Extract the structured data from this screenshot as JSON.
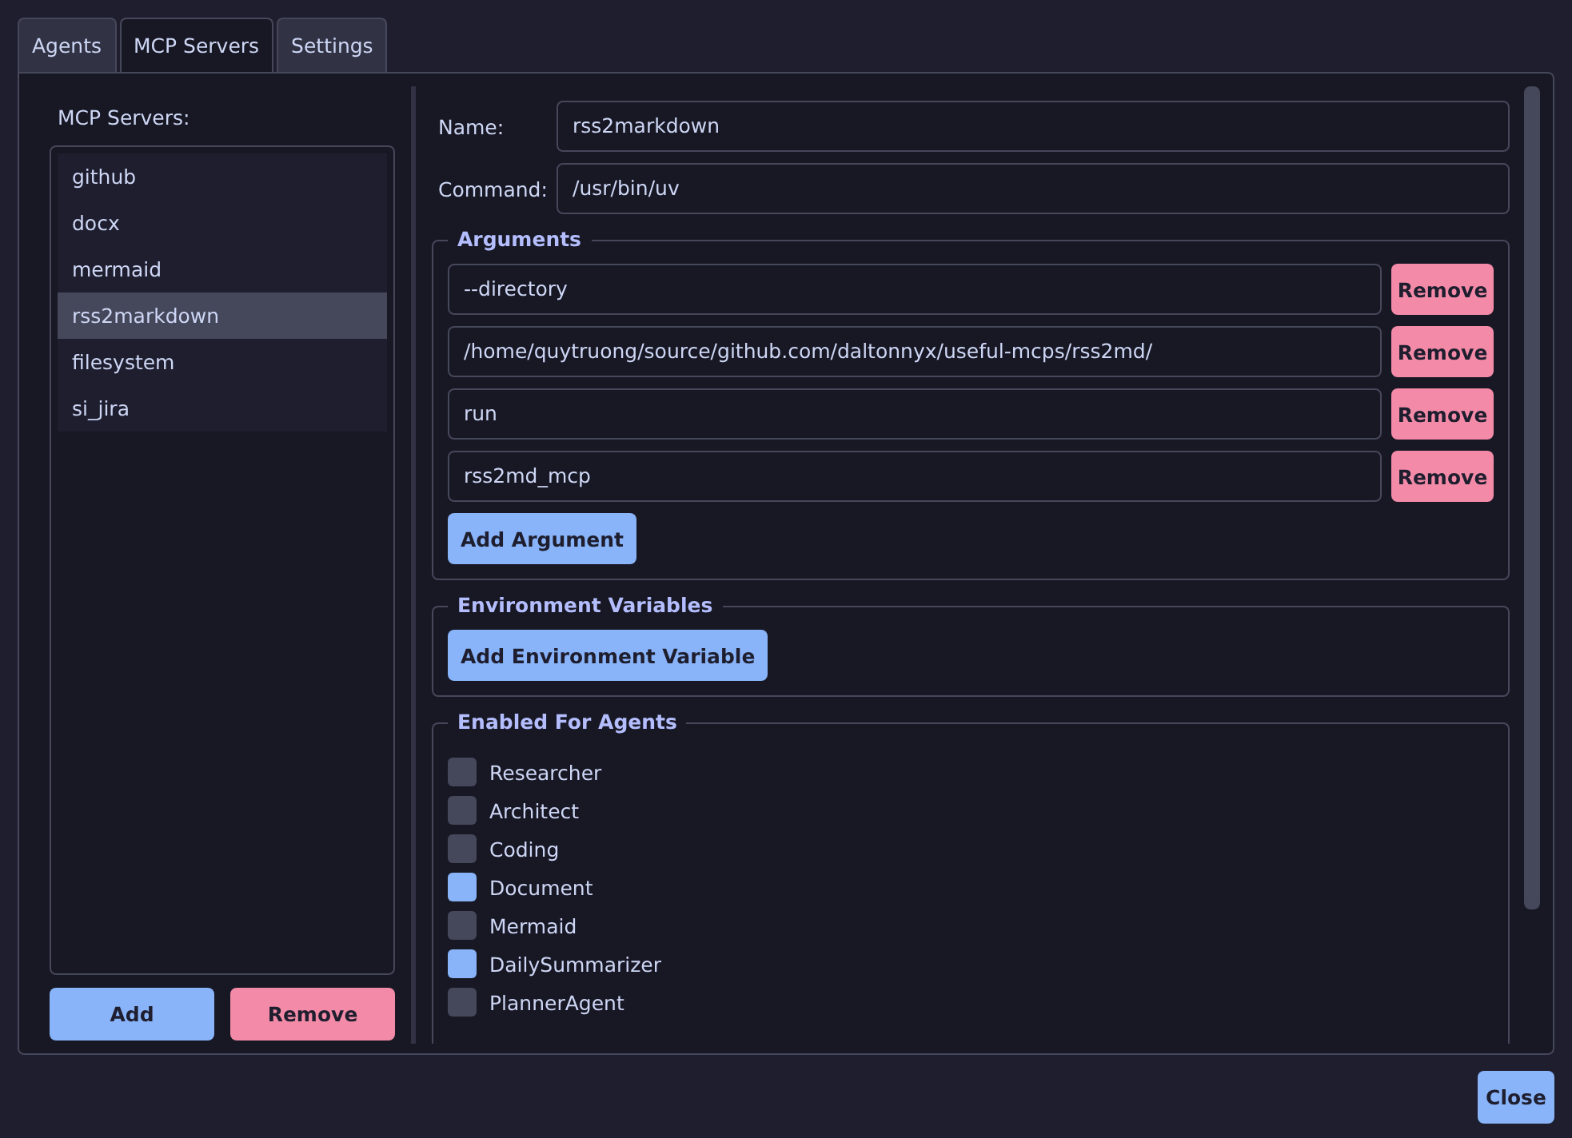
{
  "tabs": [
    {
      "label": "Agents",
      "selected": false
    },
    {
      "label": "MCP Servers",
      "selected": true
    },
    {
      "label": "Settings",
      "selected": false
    }
  ],
  "servers": {
    "title": "MCP Servers:",
    "items": [
      {
        "label": "github",
        "selected": false
      },
      {
        "label": "docx",
        "selected": false
      },
      {
        "label": "mermaid",
        "selected": false
      },
      {
        "label": "rss2markdown",
        "selected": true
      },
      {
        "label": "filesystem",
        "selected": false
      },
      {
        "label": "si_jira",
        "selected": false
      }
    ],
    "buttons": {
      "add": "Add",
      "remove": "Remove"
    }
  },
  "form": {
    "name_label": "Name:",
    "name": "rss2markdown",
    "command_label": "Command:",
    "command": "/usr/bin/uv"
  },
  "arguments": {
    "title": "Arguments",
    "items": [
      {
        "value": "--directory",
        "remove": "Remove"
      },
      {
        "value": "/home/quytruong/source/github.com/daltonnyx/useful-mcps/rss2md/",
        "remove": "Remove"
      },
      {
        "value": "run",
        "remove": "Remove"
      },
      {
        "value": "rss2md_mcp",
        "remove": "Remove"
      }
    ],
    "add": "Add Argument"
  },
  "environment": {
    "title": "Environment Variables",
    "add": "Add Environment Variable"
  },
  "agents": {
    "title": "Enabled For Agents",
    "items": [
      {
        "label": "Researcher",
        "checked": false
      },
      {
        "label": "Architect",
        "checked": false
      },
      {
        "label": "Coding",
        "checked": false
      },
      {
        "label": "Document",
        "checked": true
      },
      {
        "label": "Mermaid",
        "checked": false
      },
      {
        "label": "DailySummarizer",
        "checked": true
      },
      {
        "label": "PlannerAgent",
        "checked": false
      }
    ]
  },
  "close": "Close"
}
